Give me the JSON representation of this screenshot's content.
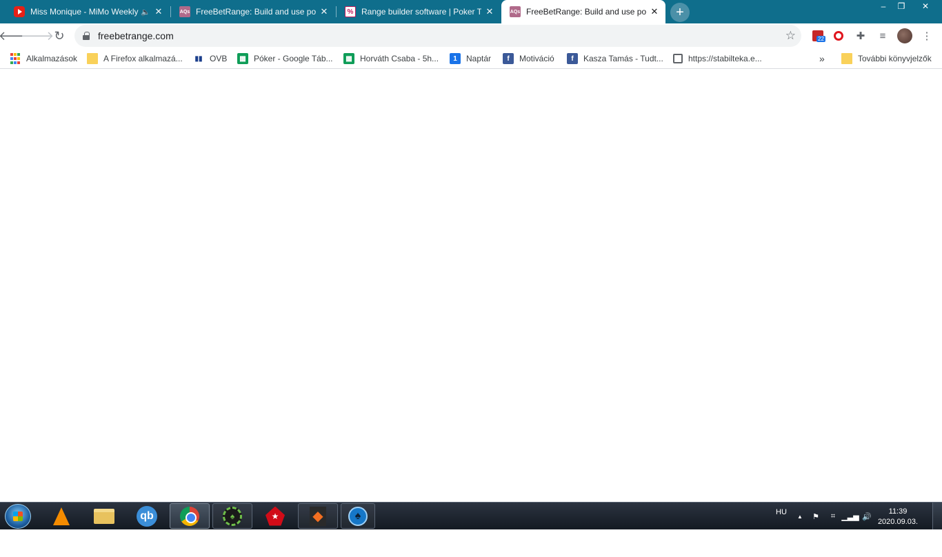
{
  "window": {
    "tabs": [
      {
        "title": "Miss Monique - MiMo Weekly",
        "favicon": "youtube-icon",
        "audio": true
      },
      {
        "title": "FreeBetRange: Build and use poker",
        "favicon": "aqs-icon"
      },
      {
        "title": "Range builder software | Poker Tools",
        "favicon": "percent-icon"
      },
      {
        "title": "FreeBetRange: Build and use poker",
        "favicon": "aqs-icon",
        "active": true
      }
    ],
    "controls": {
      "minimize": "‒",
      "restore": "❐",
      "close": "✕"
    },
    "theme_color": "#0f6e8c"
  },
  "toolbar": {
    "url": "freebetrange.com",
    "extension_badge": "22"
  },
  "bookmarks": [
    {
      "label": "Alkalmazások",
      "icon": "apps-grid-icon"
    },
    {
      "label": "A Firefox alkalmazá...",
      "icon": "folder-icon"
    },
    {
      "label": "OVB",
      "icon": "ovb-icon"
    },
    {
      "label": "Póker - Google Táb...",
      "icon": "sheets-icon"
    },
    {
      "label": "Horváth Csaba - 5h...",
      "icon": "sheets-icon"
    },
    {
      "label": "Naptár",
      "icon": "calendar-icon"
    },
    {
      "label": "Motiváció",
      "icon": "facebook-icon"
    },
    {
      "label": "Kasza Tamás - Tudt...",
      "icon": "facebook-icon"
    },
    {
      "label": "https://stabilteka.e...",
      "icon": "globe-icon"
    }
  ],
  "bookmarks_more": "»",
  "other_bookmarks": "További könyvjelzők",
  "taskbar": {
    "language": "HU",
    "time": "11:39",
    "date": "2020.09.03.",
    "apps": [
      "vlc-icon",
      "explorer-icon",
      "qbittorrent-icon",
      "chrome-icon",
      "poker-client-icon",
      "pokerstars-icon",
      "partypoker-icon",
      "spade-app-icon"
    ]
  }
}
